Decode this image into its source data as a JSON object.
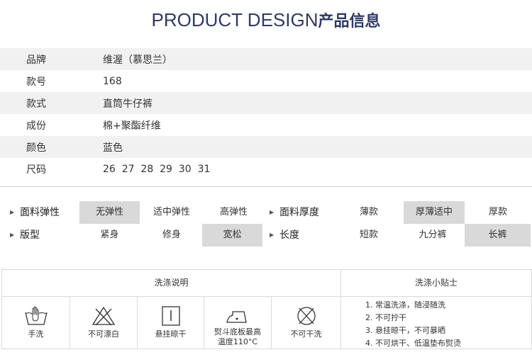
{
  "header": {
    "title_en": "PRODUCT DESIGN",
    "title_cn": "产品信息"
  },
  "info": [
    {
      "key": "品牌",
      "value": "维渥（慕思兰）"
    },
    {
      "key": "款号",
      "value": "168"
    },
    {
      "key": "款式",
      "value": "直筒牛仔裤"
    },
    {
      "key": "成份",
      "value": "棉+聚酯纤维"
    },
    {
      "key": "颜色",
      "value": "蓝色"
    },
    {
      "key": "尺码",
      "value": "26  27  28  29  30  31"
    }
  ],
  "attributes": {
    "elasticity": {
      "label": "面料弹性",
      "options": [
        "无弹性",
        "适中弹性",
        "高弹性"
      ],
      "selected": "无弹性"
    },
    "thickness": {
      "label": "面料厚度",
      "options": [
        "薄款",
        "厚薄适中",
        "厚款"
      ],
      "selected": "厚薄适中"
    },
    "fit": {
      "label": "版型",
      "options": [
        "紧身",
        "修身",
        "宽松"
      ],
      "selected": "宽松"
    },
    "length": {
      "label": "长度",
      "options": [
        "短款",
        "九分裤",
        "长裤"
      ],
      "selected": "长裤"
    }
  },
  "wash": {
    "instructions_title": "洗涤说明",
    "tips_title": "洗涤小贴士",
    "icons": [
      {
        "icon": "hand-wash-icon",
        "label": "手洗"
      },
      {
        "icon": "no-bleach-icon",
        "label": "不可漂白"
      },
      {
        "icon": "hang-dry-icon",
        "label": "悬挂晾干"
      },
      {
        "icon": "iron-icon",
        "label": "熨斗底板最高\n温度110°C"
      },
      {
        "icon": "no-dry-clean-icon",
        "label": "不可干洗"
      }
    ],
    "tips": [
      "1. 常温洗涤，随浸随洗",
      "2. 不可拧干",
      "3. 悬挂晾干，不可暴晒",
      "4. 不可烘干、低温垫布熨烫"
    ]
  },
  "colors": {
    "title": "#2f3a66",
    "row_shade": "#f1f1f1",
    "selected": "#d9d9d9",
    "border": "#d9d9d9"
  }
}
